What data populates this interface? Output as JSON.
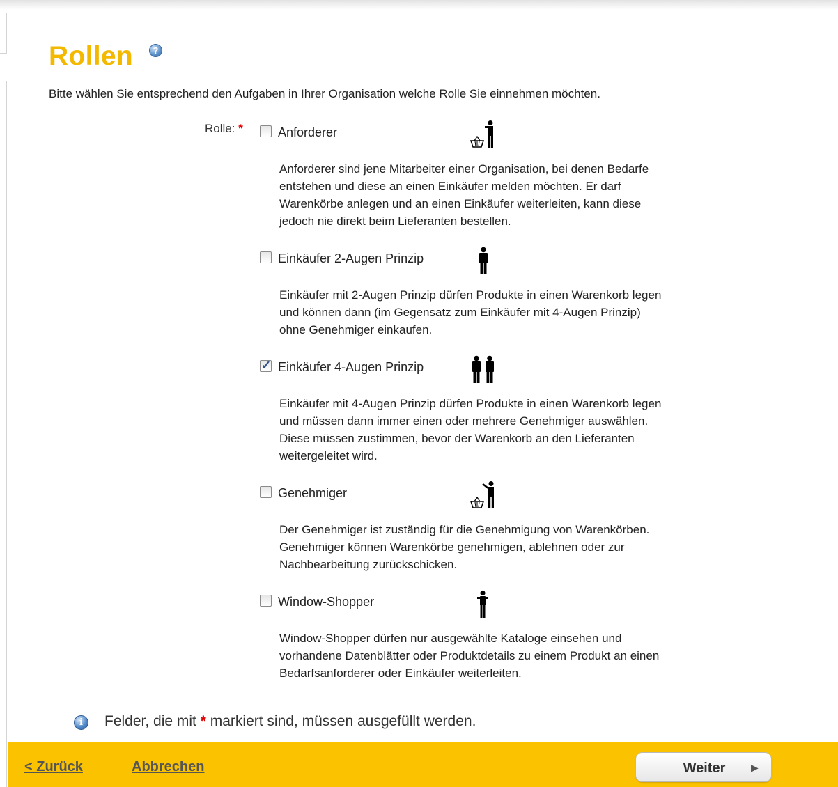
{
  "page": {
    "title": "Rollen",
    "intro": "Bitte wählen Sie entsprechend den Aufgaben in Ihrer Organisation welche Rolle Sie einnehmen möchten."
  },
  "form": {
    "role_label": "Rolle:",
    "required_marker": "*",
    "options": [
      {
        "label": "Anforderer",
        "checked": false,
        "icon": "person-with-basket-icon",
        "description": [
          "Anforderer sind jene Mitarbeiter einer Organisation, bei denen Bedarfe",
          "entstehen und diese an einen Einkäufer melden möchten. Er darf",
          "Warenkörbe anlegen und an einen Einkäufer weiterleiten, kann diese",
          "jedoch nie direkt beim Lieferanten bestellen."
        ]
      },
      {
        "label": "Einkäufer 2-Augen Prinzip",
        "checked": false,
        "icon": "person-icon",
        "description": [
          "Einkäufer mit 2-Augen Prinzip dürfen Produkte in einen Warenkorb legen",
          "und können dann (im Gegensatz zum Einkäufer mit 4-Augen Prinzip)",
          "ohne Genehmiger einkaufen."
        ]
      },
      {
        "label": "Einkäufer 4-Augen Prinzip",
        "checked": true,
        "icon": "two-persons-icon",
        "description": [
          "Einkäufer mit 4-Augen Prinzip dürfen Produkte in einen Warenkorb legen",
          "und müssen dann immer einen oder mehrere Genehmiger auswählen.",
          "Diese müssen zustimmen, bevor der Warenkorb an den Lieferanten",
          "weitergeleitet wird."
        ]
      },
      {
        "label": "Genehmiger",
        "checked": false,
        "icon": "person-approving-basket-icon",
        "description": [
          "Der Genehmiger ist zuständig für die Genehmigung von Warenkörben.",
          "Genehmiger können Warenkörbe genehmigen, ablehnen oder zur",
          "Nachbearbeitung zurückschicken."
        ]
      },
      {
        "label": "Window-Shopper",
        "checked": false,
        "icon": "small-person-icon",
        "description": [
          "Window-Shopper dürfen nur ausgewählte Kataloge einsehen und",
          "vorhandene Datenblätter oder Produktdetails zu einem Produkt an einen",
          "Bedarfsanforderer oder Einkäufer weiterleiten."
        ]
      }
    ]
  },
  "note": {
    "before": "Felder, die mit ",
    "marker": "*",
    "after": " markiert sind, müssen ausgefüllt werden."
  },
  "footer": {
    "back_label": "< Zurück",
    "cancel_label": "Abbrechen",
    "next_label": "Weiter"
  },
  "colors": {
    "accent": "#f3b800",
    "footer_bar": "#fbc200",
    "required": "#e00000"
  }
}
